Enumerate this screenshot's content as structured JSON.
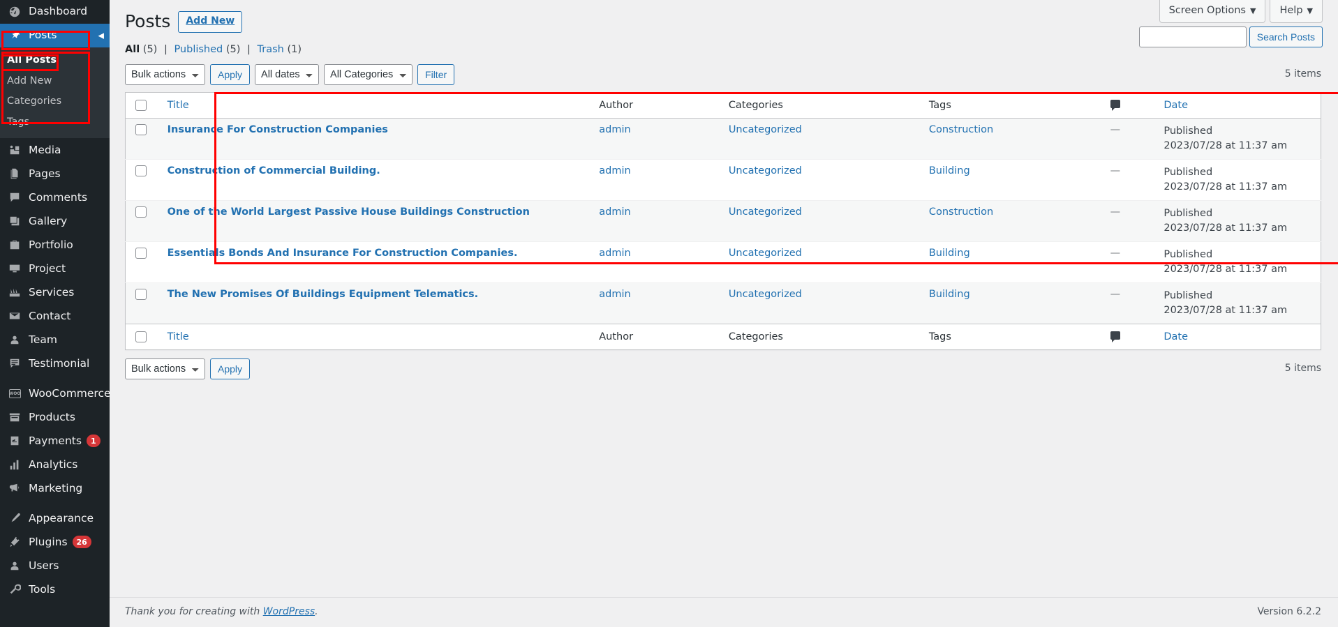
{
  "sidebar": {
    "items": [
      {
        "label": "Dashboard",
        "icon": "dashboard-icon",
        "name": "dashboard"
      },
      {
        "label": "Posts",
        "icon": "pin-icon",
        "name": "posts",
        "active": true,
        "collapse": "◀"
      },
      {
        "label": "Media",
        "icon": "media-icon",
        "name": "media"
      },
      {
        "label": "Pages",
        "icon": "pages-icon",
        "name": "pages"
      },
      {
        "label": "Comments",
        "icon": "comments-icon",
        "name": "comments"
      },
      {
        "label": "Gallery",
        "icon": "gallery-icon",
        "name": "gallery"
      },
      {
        "label": "Portfolio",
        "icon": "portfolio-icon",
        "name": "portfolio"
      },
      {
        "label": "Project",
        "icon": "project-icon",
        "name": "project"
      },
      {
        "label": "Services",
        "icon": "services-icon",
        "name": "services"
      },
      {
        "label": "Contact",
        "icon": "envelope-icon",
        "name": "contact"
      },
      {
        "label": "Team",
        "icon": "user-icon",
        "name": "team"
      },
      {
        "label": "Testimonial",
        "icon": "testimonial-icon",
        "name": "testimonial"
      },
      {
        "label": "WooCommerce",
        "icon": "woocommerce-icon",
        "name": "woocommerce",
        "sep_before": true
      },
      {
        "label": "Products",
        "icon": "products-icon",
        "name": "products"
      },
      {
        "label": "Payments",
        "icon": "payments-icon",
        "name": "payments",
        "badge": "1"
      },
      {
        "label": "Analytics",
        "icon": "analytics-icon",
        "name": "analytics"
      },
      {
        "label": "Marketing",
        "icon": "megaphone-icon",
        "name": "marketing"
      },
      {
        "label": "Appearance",
        "icon": "brush-icon",
        "name": "appearance",
        "sep_before": true
      },
      {
        "label": "Plugins",
        "icon": "plugin-icon",
        "name": "plugins",
        "badge": "26"
      },
      {
        "label": "Users",
        "icon": "users-icon",
        "name": "users"
      },
      {
        "label": "Tools",
        "icon": "wrench-icon",
        "name": "tools"
      }
    ],
    "posts_submenu": [
      {
        "label": "All Posts",
        "current": true
      },
      {
        "label": "Add New",
        "current": false
      },
      {
        "label": "Categories",
        "current": false
      },
      {
        "label": "Tags",
        "current": false
      }
    ]
  },
  "topbar": {
    "screen_options": "Screen Options",
    "help": "Help",
    "caret": "▼"
  },
  "header": {
    "title": "Posts",
    "add_new": "Add New"
  },
  "views": {
    "all_label": "All",
    "all_count": "(5)",
    "published_label": "Published",
    "published_count": "(5)",
    "trash_label": "Trash",
    "trash_count": "(1)",
    "separator": "|"
  },
  "search": {
    "value": "",
    "placeholder": "",
    "button": "Search Posts"
  },
  "toolbar": {
    "bulk_actions": "Bulk actions",
    "apply": "Apply",
    "all_dates": "All dates",
    "all_categories": "All Categories",
    "filter": "Filter",
    "items_count": "5 items"
  },
  "toolbar_bottom": {
    "bulk_actions": "Bulk actions",
    "apply": "Apply",
    "items_count": "5 items"
  },
  "table": {
    "columns": {
      "title": "Title",
      "author": "Author",
      "categories": "Categories",
      "tags": "Tags",
      "comments": "comment-bubble-icon",
      "date": "Date"
    },
    "rows": [
      {
        "title": "Insurance For Construction Companies",
        "author": "admin",
        "categories": "Uncategorized",
        "tags": "Construction",
        "comments": "—",
        "date_status": "Published",
        "date_value": "2023/07/28 at 11:37 am"
      },
      {
        "title": "Construction of Commercial Building.",
        "author": "admin",
        "categories": "Uncategorized",
        "tags": "Building",
        "comments": "—",
        "date_status": "Published",
        "date_value": "2023/07/28 at 11:37 am"
      },
      {
        "title": "One of the World Largest Passive House Buildings Construction",
        "author": "admin",
        "categories": "Uncategorized",
        "tags": "Construction",
        "comments": "—",
        "date_status": "Published",
        "date_value": "2023/07/28 at 11:37 am"
      },
      {
        "title": "Essentials Bonds And Insurance For Construction Companies.",
        "author": "admin",
        "categories": "Uncategorized",
        "tags": "Building",
        "comments": "—",
        "date_status": "Published",
        "date_value": "2023/07/28 at 11:37 am"
      },
      {
        "title": "The New Promises Of Buildings Equipment Telematics.",
        "author": "admin",
        "categories": "Uncategorized",
        "tags": "Building",
        "comments": "—",
        "date_status": "Published",
        "date_value": "2023/07/28 at 11:37 am"
      }
    ]
  },
  "footer": {
    "thanks_prefix": "Thank you for creating with ",
    "wordpress_link": "WordPress",
    "thanks_suffix": ".",
    "version": "Version 6.2.2"
  },
  "colors": {
    "accent": "#2271b1",
    "sidebar_bg": "#1d2327",
    "submenu_bg": "#2c3338",
    "badge": "#d63638",
    "annotation": "#ff0000"
  }
}
